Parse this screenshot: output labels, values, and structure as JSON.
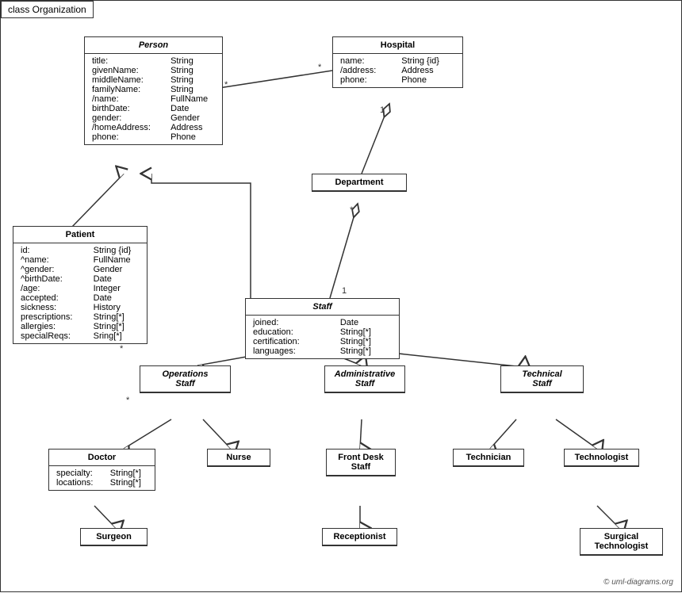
{
  "title": "class Organization",
  "copyright": "© uml-diagrams.org",
  "classes": {
    "person": {
      "name": "Person",
      "italic": true,
      "attributes": [
        [
          "title:",
          "String"
        ],
        [
          "givenName:",
          "String"
        ],
        [
          "middleName:",
          "String"
        ],
        [
          "familyName:",
          "String"
        ],
        [
          "/name:",
          "FullName"
        ],
        [
          "birthDate:",
          "Date"
        ],
        [
          "gender:",
          "Gender"
        ],
        [
          "/homeAddress:",
          "Address"
        ],
        [
          "phone:",
          "Phone"
        ]
      ]
    },
    "hospital": {
      "name": "Hospital",
      "italic": false,
      "attributes": [
        [
          "name:",
          "String {id}"
        ],
        [
          "/address:",
          "Address"
        ],
        [
          "phone:",
          "Phone"
        ]
      ]
    },
    "patient": {
      "name": "Patient",
      "italic": false,
      "attributes": [
        [
          "id:",
          "String {id}"
        ],
        [
          "^name:",
          "FullName"
        ],
        [
          "^gender:",
          "Gender"
        ],
        [
          "^birthDate:",
          "Date"
        ],
        [
          "/age:",
          "Integer"
        ],
        [
          "accepted:",
          "Date"
        ],
        [
          "sickness:",
          "History"
        ],
        [
          "prescriptions:",
          "String[*]"
        ],
        [
          "allergies:",
          "String[*]"
        ],
        [
          "specialReqs:",
          "Sring[*]"
        ]
      ]
    },
    "department": {
      "name": "Department",
      "italic": false,
      "attributes": []
    },
    "staff": {
      "name": "Staff",
      "italic": true,
      "attributes": [
        [
          "joined:",
          "Date"
        ],
        [
          "education:",
          "String[*]"
        ],
        [
          "certification:",
          "String[*]"
        ],
        [
          "languages:",
          "String[*]"
        ]
      ]
    },
    "operations_staff": {
      "name": "Operations\nStaff",
      "italic": true,
      "attributes": []
    },
    "administrative_staff": {
      "name": "Administrative\nStaff",
      "italic": true,
      "attributes": []
    },
    "technical_staff": {
      "name": "Technical\nStaff",
      "italic": true,
      "attributes": []
    },
    "doctor": {
      "name": "Doctor",
      "italic": false,
      "attributes": [
        [
          "specialty:",
          "String[*]"
        ],
        [
          "locations:",
          "String[*]"
        ]
      ]
    },
    "nurse": {
      "name": "Nurse",
      "italic": false,
      "attributes": []
    },
    "front_desk_staff": {
      "name": "Front Desk\nStaff",
      "italic": false,
      "attributes": []
    },
    "technician": {
      "name": "Technician",
      "italic": false,
      "attributes": []
    },
    "technologist": {
      "name": "Technologist",
      "italic": false,
      "attributes": []
    },
    "surgeon": {
      "name": "Surgeon",
      "italic": false,
      "attributes": []
    },
    "receptionist": {
      "name": "Receptionist",
      "italic": false,
      "attributes": []
    },
    "surgical_technologist": {
      "name": "Surgical\nTechnologist",
      "italic": false,
      "attributes": []
    }
  }
}
